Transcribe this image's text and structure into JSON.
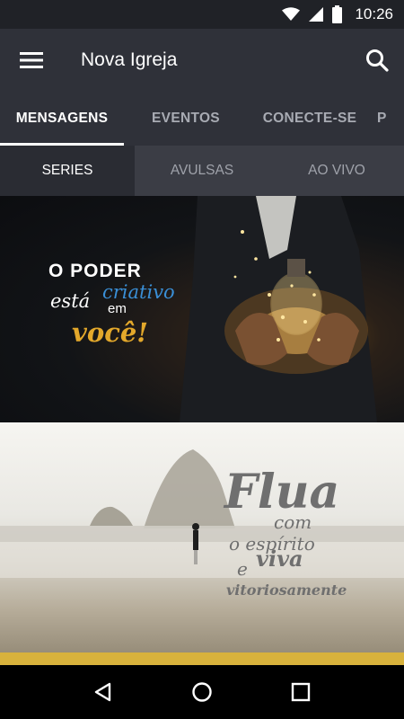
{
  "status_bar": {
    "time": "10:26",
    "icons": [
      "wifi-icon",
      "cell-signal-icon",
      "battery-icon"
    ]
  },
  "app_bar": {
    "title": "Nova Igreja",
    "menu_icon": "hamburger-menu-icon",
    "search_icon": "search-icon"
  },
  "tabs": [
    {
      "label": "MENSAGENS",
      "active": true
    },
    {
      "label": "EVENTOS",
      "active": false
    },
    {
      "label": "CONECTE-SE",
      "active": false
    },
    {
      "label": "P",
      "active": false
    }
  ],
  "sub_tabs": [
    {
      "label": "SERIES",
      "active": true
    },
    {
      "label": "AVULSAS",
      "active": false
    },
    {
      "label": "AO VIVO",
      "active": false
    }
  ],
  "series": [
    {
      "line1": "O PODER",
      "line2a": "está",
      "line2b": "criativo",
      "line3a": "em",
      "line3b": "você!"
    },
    {
      "line1": "Flua",
      "line2": "com",
      "line3": "o espírito",
      "line4a": "e",
      "line4b": "viva",
      "line5": "vitoriosamente"
    }
  ],
  "colors": {
    "appbar": "#2f3139",
    "accent_gold": "#d8b23c",
    "accent_blue": "#3a8fd6"
  },
  "nav_bar": {
    "icons": [
      "back-icon",
      "home-icon",
      "recents-icon"
    ]
  }
}
